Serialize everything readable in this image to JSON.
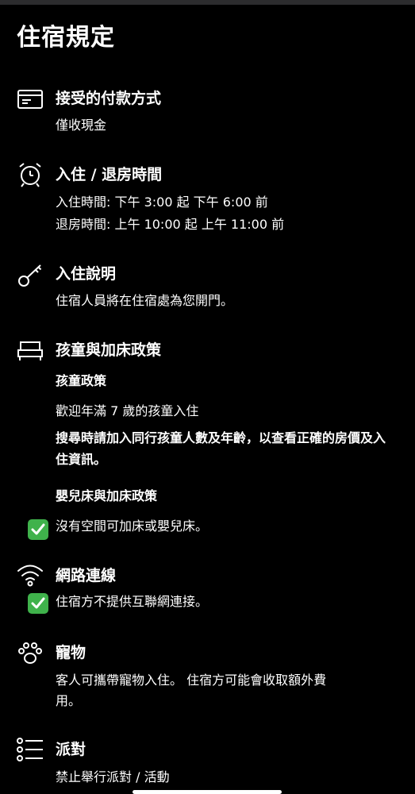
{
  "page": {
    "title": "住宿規定"
  },
  "sections": {
    "payment": {
      "title": "接受的付款方式",
      "text": "僅收現金",
      "icon": "credit-card-icon"
    },
    "checkin": {
      "title": "入住 / 退房時間",
      "checkin_time": "入住時間: 下午 3:00 起 下午 6:00 前",
      "checkout_time": "退房時間: 上午 10:00 起 上午 11:00 前",
      "icon": "alarm-clock-icon"
    },
    "instructions": {
      "title": "入住說明",
      "text": "住宿人員將在住宿處為您開門。",
      "icon": "key-icon"
    },
    "children": {
      "title": "孩童與加床政策",
      "child_policy_heading": "孩童政策",
      "child_policy_text": "歡迎年滿 7 歲的孩童入住",
      "search_note": "搜尋時請加入同行孩童人數及年齡，以查看正確的房價及入住資訊。",
      "crib_heading": "嬰兒床與加床政策",
      "crib_text": "沒有空間可加床或嬰兒床。",
      "icon": "bed-icon"
    },
    "internet": {
      "title": "網路連線",
      "text": "住宿方不提供互聯網連接。",
      "icon": "wifi-icon"
    },
    "pets": {
      "title": "寵物",
      "text": "客人可攜帶寵物入住。 住宿方可能會收取額外費用。",
      "icon": "paw-icon"
    },
    "parties": {
      "title": "派對",
      "text": "禁止舉行派對 / 活動",
      "icon": "list-icon"
    }
  },
  "colors": {
    "background": "#000000",
    "text": "#ffffff",
    "check_green": "#3fb24b"
  }
}
